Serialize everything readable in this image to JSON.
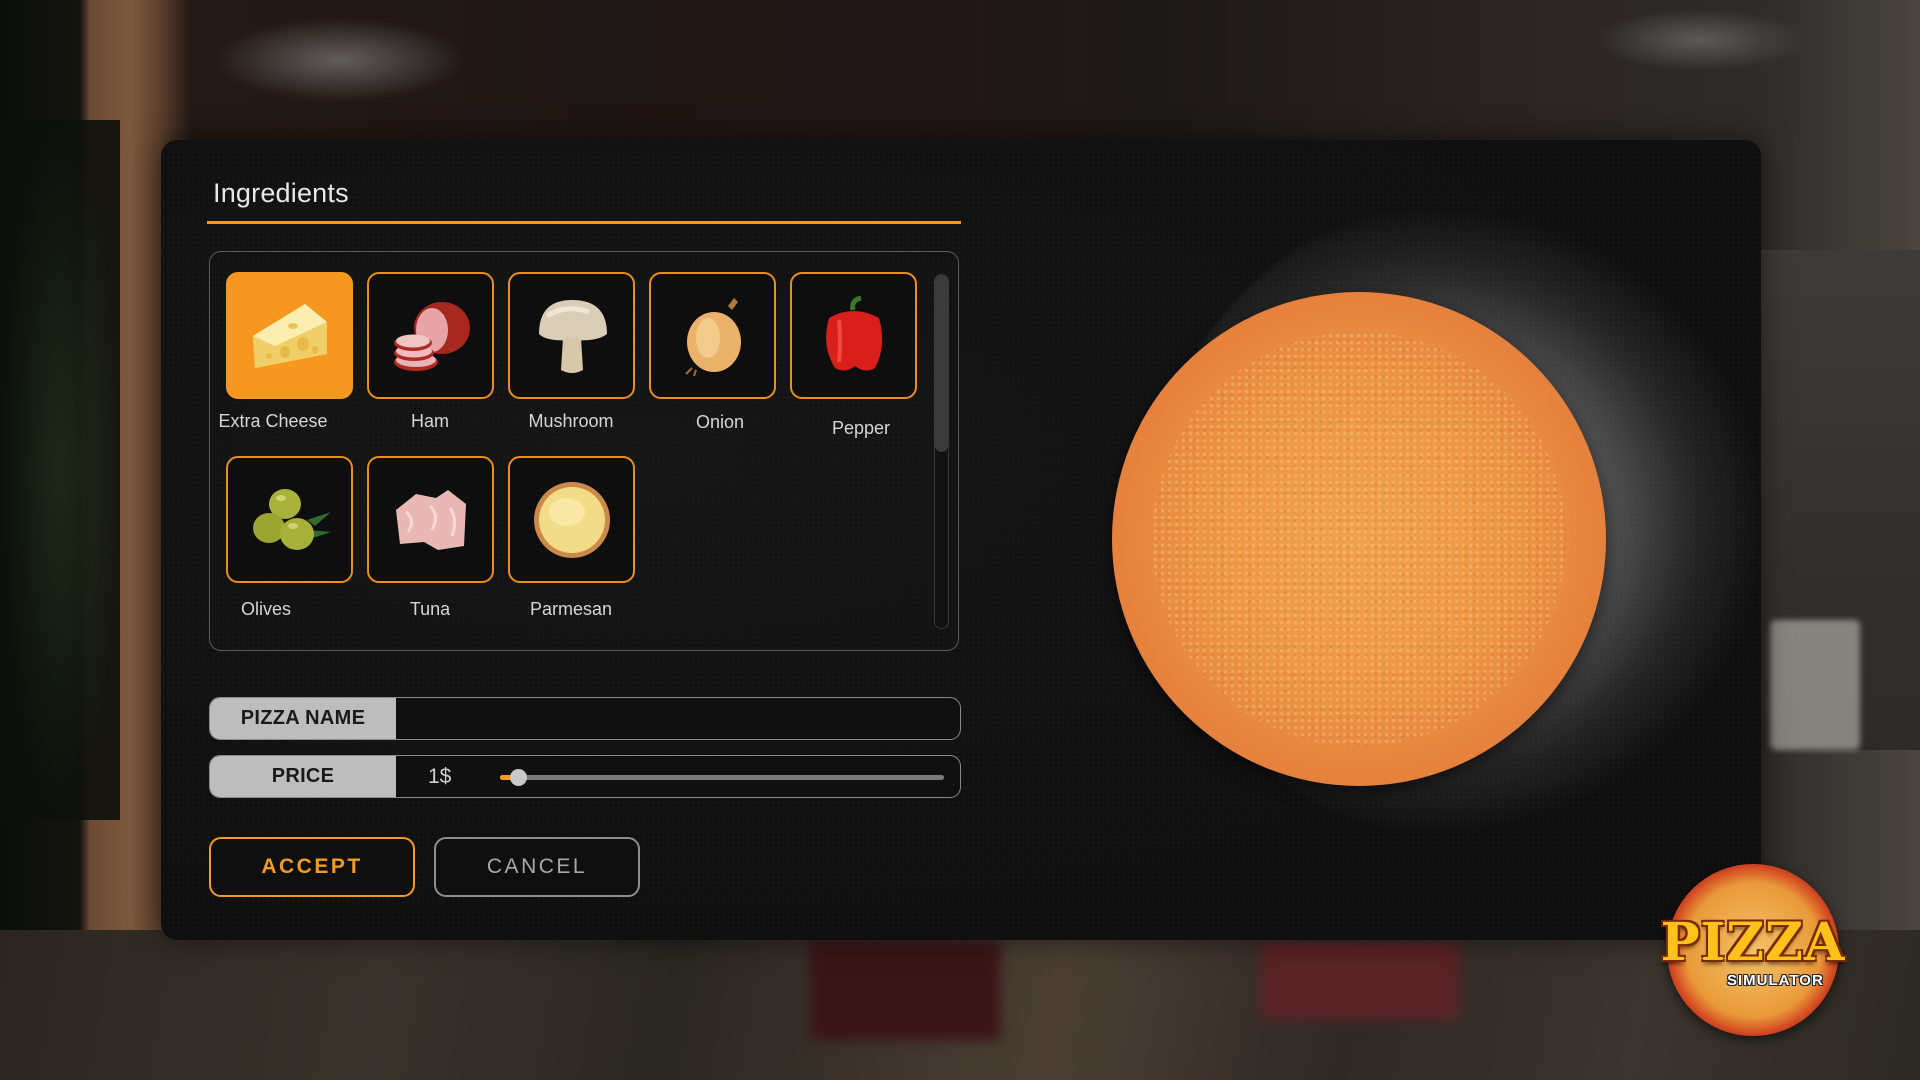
{
  "panel": {
    "title": "Ingredients"
  },
  "ingredients": [
    {
      "label": "Extra Cheese",
      "icon": "cheese-icon",
      "selected": true
    },
    {
      "label": "Ham",
      "icon": "ham-icon",
      "selected": false
    },
    {
      "label": "Mushroom",
      "icon": "mushroom-icon",
      "selected": false
    },
    {
      "label": "Onion",
      "icon": "onion-icon",
      "selected": false
    },
    {
      "label": "Pepper",
      "icon": "pepper-icon",
      "selected": false
    },
    {
      "label": "Olives",
      "icon": "olives-icon",
      "selected": false
    },
    {
      "label": "Tuna",
      "icon": "tuna-icon",
      "selected": false
    },
    {
      "label": "Parmesan",
      "icon": "parmesan-icon",
      "selected": false
    }
  ],
  "scrollbar": {
    "thumb_fraction": 0.5,
    "position": 0
  },
  "form": {
    "pizza_name_label": "PIZZA NAME",
    "pizza_name_value": "",
    "price_label": "PRICE",
    "price_value": "1$",
    "price_slider_fraction": 0.04
  },
  "buttons": {
    "accept": "ACCEPT",
    "cancel": "CANCEL"
  },
  "logo": {
    "title": "PIZZA",
    "subtitle": "SIMULATOR"
  },
  "colors": {
    "accent": "#F39A20",
    "selected_tile": "#F6981F",
    "label_bg": "#BDBDBD"
  }
}
